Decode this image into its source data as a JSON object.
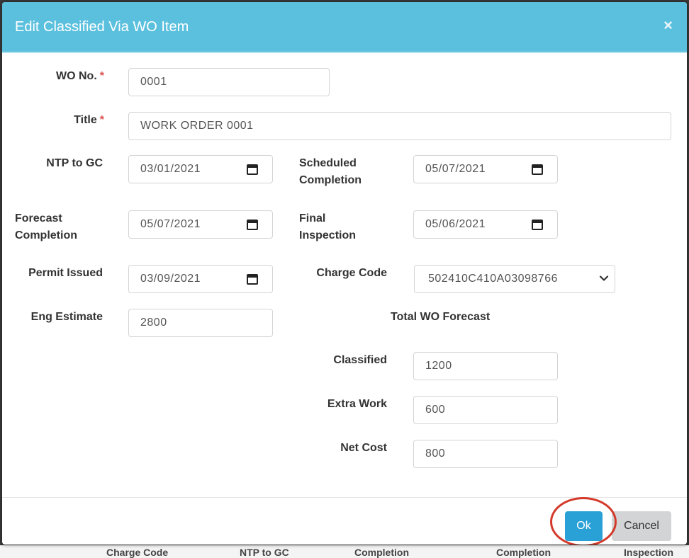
{
  "background_table_headers": [
    "Charge Code",
    "NTP to GC",
    "Completion",
    "Completion",
    "Inspection"
  ],
  "modal": {
    "title": "Edit Classified Via WO Item",
    "close_symbol": "×"
  },
  "form": {
    "required_mark": "*",
    "wo_no": {
      "label": "WO No.",
      "value": "0001"
    },
    "title": {
      "label": "Title",
      "value": "WORK ORDER 0001"
    },
    "ntp_to_gc": {
      "label": "NTP to GC",
      "value": "03/01/2021"
    },
    "scheduled_completion": {
      "label_line1": "Scheduled",
      "label_line2": "Completion",
      "value": "05/07/2021"
    },
    "forecast_completion": {
      "label_line1": "Forecast",
      "label_line2": "Completion",
      "value": "05/07/2021"
    },
    "final_inspection": {
      "label_line1": "Final",
      "label_line2": "Inspection",
      "value": "05/06/2021"
    },
    "permit_issued": {
      "label": "Permit Issued",
      "value": "03/09/2021"
    },
    "charge_code": {
      "label": "Charge Code",
      "value": "502410C410A03098766"
    },
    "eng_estimate": {
      "label": "Eng Estimate",
      "value": "2800"
    },
    "total_wo_forecast": {
      "heading": "Total WO Forecast"
    },
    "classified": {
      "label": "Classified",
      "value": "1200"
    },
    "extra_work": {
      "label": "Extra Work",
      "value": "600"
    },
    "net_cost": {
      "label": "Net Cost",
      "value": "800"
    }
  },
  "footer": {
    "ok_label": "Ok",
    "cancel_label": "Cancel"
  },
  "colors": {
    "header": "#5bc0de",
    "ok_button": "#2aa1d6",
    "cancel_button": "#d2d4d5",
    "required": "#d9534f",
    "highlight": "#d43a2b"
  },
  "icons": [
    "close-icon",
    "calendar-icon",
    "chevron-down-icon"
  ]
}
